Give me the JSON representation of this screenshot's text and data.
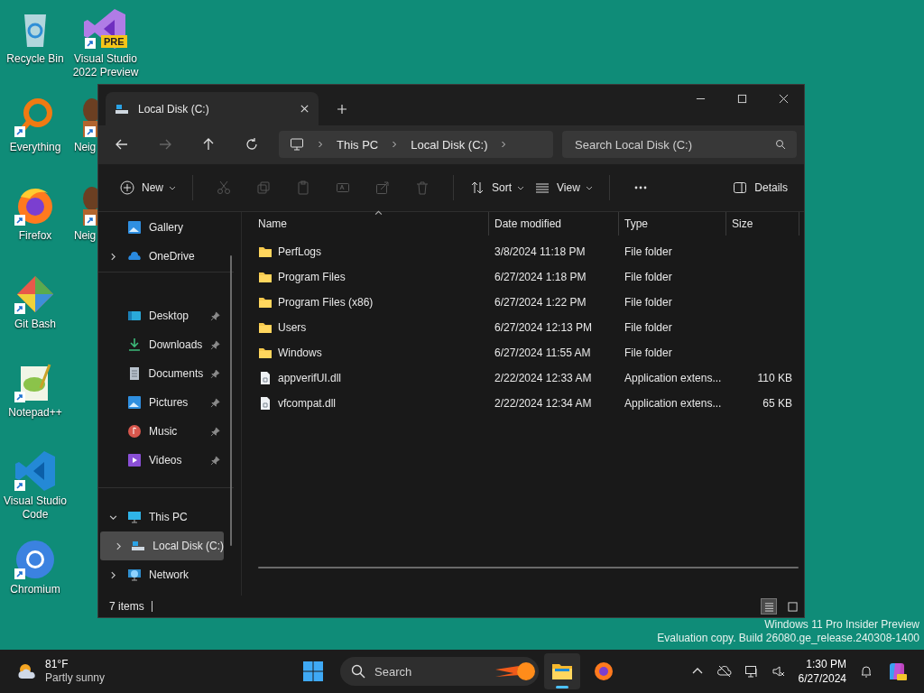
{
  "desktop": {
    "columns": [
      [
        {
          "label": "Recycle Bin",
          "kind": "recycle",
          "shortcut": false
        },
        {
          "label": "Everything",
          "kind": "everything",
          "shortcut": true
        },
        {
          "label": "Firefox",
          "kind": "firefox",
          "shortcut": true
        },
        {
          "label": "Git Bash",
          "kind": "gitbash",
          "shortcut": true
        },
        {
          "label": "Notepad++",
          "kind": "notepad",
          "shortcut": true
        },
        {
          "label": "Visual Studio Code",
          "kind": "vscode",
          "shortcut": true
        },
        {
          "label": "Chromium",
          "kind": "chromium",
          "shortcut": true
        }
      ],
      [
        {
          "label": "Visual Studio 2022 Preview",
          "kind": "vspreview",
          "shortcut": true,
          "badge": "PRE"
        },
        {
          "label": "Neig",
          "kind": "figure",
          "shortcut": true
        },
        {
          "label": "Neig",
          "kind": "figure",
          "shortcut": true
        }
      ]
    ],
    "os_notice": [
      "Windows 11 Pro Insider Preview",
      "Evaluation copy. Build 26080.ge_release.240308-1400"
    ]
  },
  "window": {
    "tab": {
      "title": "Local Disk (C:)"
    },
    "breadcrumbs": [
      "This PC",
      "Local Disk (C:)"
    ],
    "search": {
      "placeholder": "Search Local Disk (C:)"
    },
    "toolbar": {
      "new": "New",
      "sort": "Sort",
      "view": "View",
      "details": "Details"
    },
    "sidebar": {
      "groups": [
        {
          "items": [
            {
              "label": "Gallery",
              "kind": "gallery",
              "selected": false
            },
            {
              "label": "OneDrive",
              "kind": "onedrive",
              "selected": false,
              "expanded": false
            }
          ]
        },
        {
          "items": [
            {
              "label": "Desktop",
              "kind": "desktop",
              "selected": false,
              "pinned": true
            },
            {
              "label": "Downloads",
              "kind": "downloads",
              "selected": false,
              "pinned": true
            },
            {
              "label": "Documents",
              "kind": "documents",
              "selected": false,
              "pinned": true
            },
            {
              "label": "Pictures",
              "kind": "gallery",
              "selected": false,
              "pinned": true
            },
            {
              "label": "Music",
              "kind": "music",
              "selected": false,
              "pinned": true
            },
            {
              "label": "Videos",
              "kind": "videos",
              "selected": false,
              "pinned": true
            }
          ]
        },
        {
          "items": [
            {
              "label": "This PC",
              "kind": "pc",
              "selected": false,
              "expanded": true,
              "children": [
                {
                  "label": "Local Disk (C:)",
                  "kind": "drive",
                  "selected": true,
                  "expanded": false
                }
              ]
            },
            {
              "label": "Network",
              "kind": "network",
              "selected": false,
              "expanded": false
            }
          ]
        }
      ]
    },
    "table": {
      "columns": [
        "Name",
        "Date modified",
        "Type",
        "Size"
      ],
      "rows": [
        {
          "name": "PerfLogs",
          "kind": "folder",
          "date": "3/8/2024 11:18 PM",
          "type": "File folder"
        },
        {
          "name": "Program Files",
          "kind": "folder",
          "date": "6/27/2024 1:18 PM",
          "type": "File folder"
        },
        {
          "name": "Program Files (x86)",
          "kind": "folder",
          "date": "6/27/2024 1:22 PM",
          "type": "File folder"
        },
        {
          "name": "Users",
          "kind": "folder",
          "date": "6/27/2024 12:13 PM",
          "type": "File folder"
        },
        {
          "name": "Windows",
          "kind": "folder",
          "date": "6/27/2024 11:55 AM",
          "type": "File folder"
        },
        {
          "name": "appverifUI.dll",
          "kind": "file",
          "date": "2/22/2024 12:33 AM",
          "type": "Application extens...",
          "size": "110 KB"
        },
        {
          "name": "vfcompat.dll",
          "kind": "file",
          "date": "2/22/2024 12:34 AM",
          "type": "Application extens...",
          "size": "65 KB"
        }
      ]
    },
    "status_bar": {
      "count": "7 items",
      "view_modes": [
        {
          "kind": "details",
          "selected": true
        },
        {
          "kind": "tiles",
          "selected": false
        }
      ]
    }
  },
  "taskbar": {
    "weather": {
      "temperature": "81°F",
      "condition": "Partly sunny"
    },
    "search": {
      "placeholder": "Search"
    },
    "apps": [
      {
        "kind": "explorer",
        "active": true
      },
      {
        "kind": "firefox",
        "active": false
      }
    ],
    "time": "1:30 PM",
    "date": "6/27/2024"
  }
}
